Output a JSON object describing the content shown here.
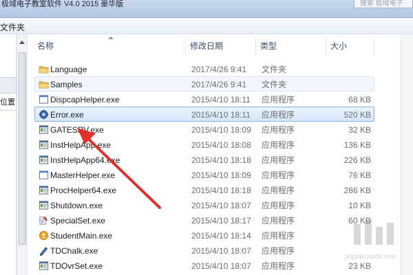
{
  "window": {
    "title": "极域电子教室软件 V4.0 2015 豪华版",
    "search_placeholder": "搜索 极域电子"
  },
  "menu": {
    "item": "文件夹"
  },
  "nav": {
    "location_label": "位置"
  },
  "columns": {
    "name": "名称",
    "date": "修改日期",
    "type": "类型",
    "size": "大小"
  },
  "files": [
    {
      "name": "Language",
      "date": "2017/4/26 9:41",
      "type": "文件夹",
      "size": "",
      "icon": "folder-icon"
    },
    {
      "name": "Samples",
      "date": "2017/4/26 9:41",
      "type": "文件夹",
      "size": "",
      "icon": "folder-icon"
    },
    {
      "name": "DispcapHelper.exe",
      "date": "2015/4/10 18:11",
      "type": "应用程序",
      "size": "68 KB",
      "icon": "blank-window-icon"
    },
    {
      "name": "Error.exe",
      "date": "2015/4/10 18:11",
      "type": "应用程序",
      "size": "520 KB",
      "icon": "gear-icon"
    },
    {
      "name": "GATESRV.exe",
      "date": "2015/4/10 18:09",
      "type": "应用程序",
      "size": "32 KB",
      "icon": "app-window-icon"
    },
    {
      "name": "InstHelpApp.exe",
      "date": "2015/4/10 18:08",
      "type": "应用程序",
      "size": "136 KB",
      "icon": "app-window-icon"
    },
    {
      "name": "InstHelpApp64.exe",
      "date": "2015/4/10 18:18",
      "type": "应用程序",
      "size": "226 KB",
      "icon": "app-window-icon"
    },
    {
      "name": "MasterHelper.exe",
      "date": "2015/4/10 18:09",
      "type": "应用程序",
      "size": "76 KB",
      "icon": "blank-window-icon"
    },
    {
      "name": "ProcHelper64.exe",
      "date": "2015/4/10 18:18",
      "type": "应用程序",
      "size": "286 KB",
      "icon": "app-window-icon"
    },
    {
      "name": "Shutdown.exe",
      "date": "2015/4/10 18:07",
      "type": "应用程序",
      "size": "10 KB",
      "icon": "app-window-icon"
    },
    {
      "name": "SpecialSet.exe",
      "date": "2015/4/10 18:17",
      "type": "应用程序",
      "size": "60 KB",
      "icon": "settings-tools-icon"
    },
    {
      "name": "StudentMain.exe",
      "date": "2015/4/10 18:14",
      "type": "应用程序",
      "size": "",
      "icon": "student-icon"
    },
    {
      "name": "TDChalk.exe",
      "date": "2015/4/10 18:07",
      "type": "应用程序",
      "size": "",
      "icon": "chalk-pen-icon"
    },
    {
      "name": "TDOvrSet.exe",
      "date": "2015/4/10 18:07",
      "type": "应用程序",
      "size": "23 KB",
      "icon": "app-window-icon"
    }
  ],
  "selected_file": "Error.exe",
  "hovered_file": "Samples",
  "colors": {
    "annotation_arrow": "#e0312a",
    "selection": "#d6e7fb",
    "folder": "#e8c05a"
  }
}
